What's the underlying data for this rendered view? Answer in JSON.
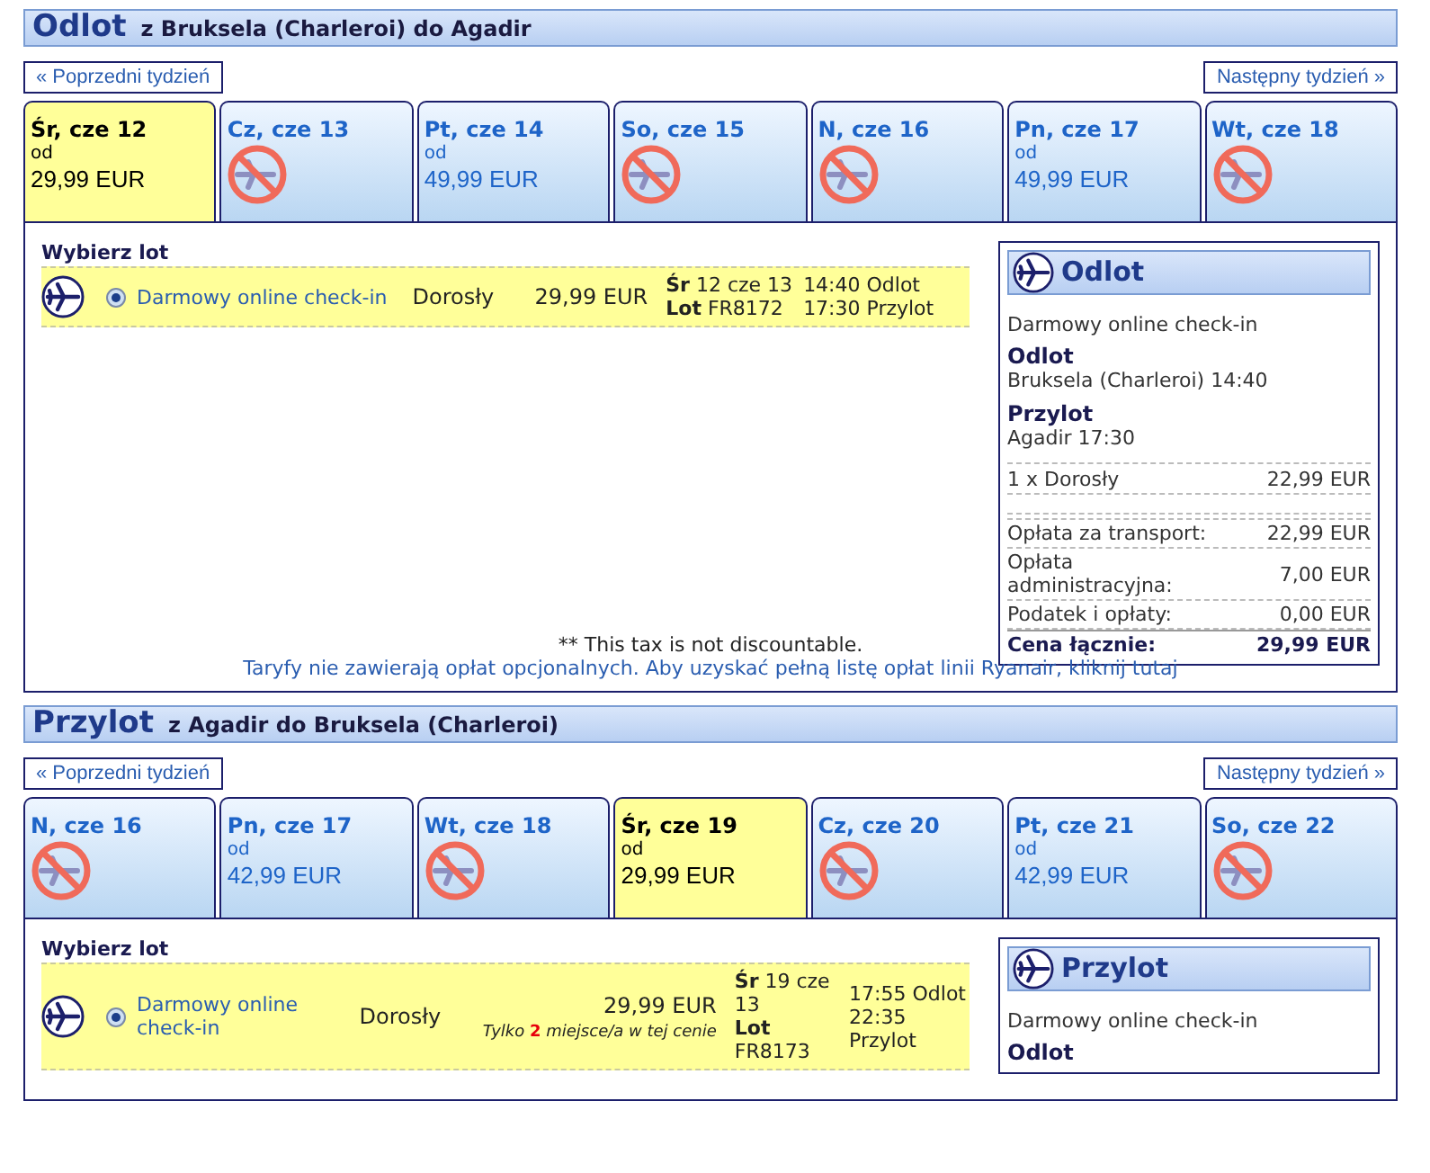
{
  "sections": [
    {
      "title": "Odlot",
      "route": "z Bruksela (Charleroi) do Agadir",
      "prev_week": "« Poprzedni tydzień",
      "next_week": "Następny tydzień »",
      "days": [
        {
          "label": "Śr, cze 12",
          "selected": true,
          "available": true,
          "from": "od",
          "price": "29,99 EUR"
        },
        {
          "label": "Cz, cze 13",
          "selected": false,
          "available": false
        },
        {
          "label": "Pt, cze 14",
          "selected": false,
          "available": true,
          "from": "od",
          "price": "49,99 EUR"
        },
        {
          "label": "So, cze 15",
          "selected": false,
          "available": false
        },
        {
          "label": "N, cze 16",
          "selected": false,
          "available": false
        },
        {
          "label": "Pn, cze 17",
          "selected": false,
          "available": true,
          "from": "od",
          "price": "49,99 EUR"
        },
        {
          "label": "Wt, cze 18",
          "selected": false,
          "available": false
        }
      ],
      "choose_label": "Wybierz lot",
      "fares": [
        {
          "selected": true,
          "name": "Darmowy online check-in",
          "passenger": "Dorosły",
          "price": "29,99 EUR",
          "date": "**Śr** 12 cze 13",
          "flight": "**Lot** FR8172",
          "departure": "14:40 Odlot",
          "arrival": "17:30 Przylot"
        }
      ],
      "summary": {
        "title": "Odlot",
        "fare": "Darmowy online check-in",
        "legs": [
          {
            "label": "Odlot",
            "value": "Bruksela (Charleroi) 14:40"
          },
          {
            "label": "Przylot",
            "value": "Agadir 17:30"
          }
        ],
        "passengers": [
          {
            "label": "1 x Dorosły",
            "value": "22,99 EUR"
          }
        ],
        "fees": [
          {
            "label": "Opłata za transport:",
            "value": "22,99 EUR"
          },
          {
            "label": "Opłata administracyjna:",
            "value": "7,00 EUR"
          },
          {
            "label": "Podatek i opłaty:",
            "value": "0,00 EUR"
          }
        ],
        "total": {
          "label": "Cena łącznie:",
          "value": "29,99 EUR"
        }
      },
      "notes": [
        {
          "kind": "text",
          "text": "** This tax is not discountable."
        },
        {
          "kind": "link",
          "text": "Taryfy nie zawierają opłat opcjonalnych. Aby uzyskać pełną listę opłat linii Ryanair, kliknij tutaj"
        }
      ]
    },
    {
      "title": "Przylot",
      "route": "z Agadir do Bruksela (Charleroi)",
      "prev_week": "« Poprzedni tydzień",
      "next_week": "Następny tydzień »",
      "days": [
        {
          "label": "N, cze 16",
          "selected": false,
          "available": false
        },
        {
          "label": "Pn, cze 17",
          "selected": false,
          "available": true,
          "from": "od",
          "price": "42,99 EUR"
        },
        {
          "label": "Wt, cze 18",
          "selected": false,
          "available": false
        },
        {
          "label": "Śr, cze 19",
          "selected": true,
          "available": true,
          "from": "od",
          "price": "29,99 EUR"
        },
        {
          "label": "Cz, cze 20",
          "selected": false,
          "available": false
        },
        {
          "label": "Pt, cze 21",
          "selected": false,
          "available": true,
          "from": "od",
          "price": "42,99 EUR"
        },
        {
          "label": "So, cze 22",
          "selected": false,
          "available": false
        }
      ],
      "choose_label": "Wybierz lot",
      "fares": [
        {
          "selected": true,
          "name": "Darmowy online check-in",
          "passenger": "Dorosły",
          "price": "29,99 EUR",
          "note": "Tylko **2** miejsce/a w tej cenie",
          "date": "**Śr** 19 cze 13",
          "flight": "**Lot** FR8173",
          "departure": "17:55 Odlot",
          "arrival": "22:35 Przylot"
        }
      ],
      "summary": {
        "title": "Przylot",
        "fare": "Darmowy online check-in",
        "legs": [
          {
            "label": "Odlot"
          }
        ]
      }
    }
  ]
}
